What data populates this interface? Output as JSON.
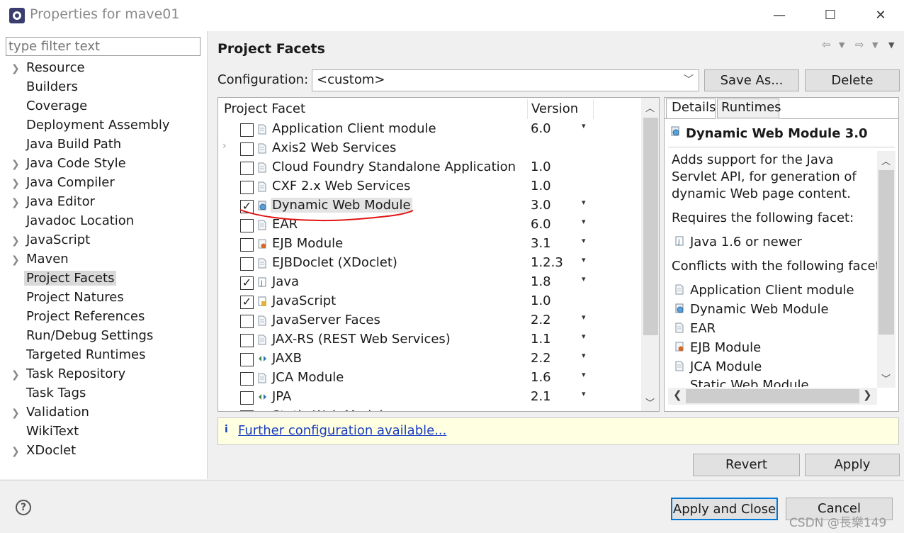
{
  "window": {
    "title": "Properties for mave01",
    "minimize": "—",
    "maximize": "☐",
    "close": "✕"
  },
  "filter": {
    "placeholder": "type filter text"
  },
  "tree": [
    {
      "label": "Resource",
      "expandable": true
    },
    {
      "label": "Builders",
      "expandable": false
    },
    {
      "label": "Coverage",
      "expandable": false
    },
    {
      "label": "Deployment Assembly",
      "expandable": false
    },
    {
      "label": "Java Build Path",
      "expandable": false
    },
    {
      "label": "Java Code Style",
      "expandable": true
    },
    {
      "label": "Java Compiler",
      "expandable": true
    },
    {
      "label": "Java Editor",
      "expandable": true
    },
    {
      "label": "Javadoc Location",
      "expandable": false
    },
    {
      "label": "JavaScript",
      "expandable": true
    },
    {
      "label": "Maven",
      "expandable": true
    },
    {
      "label": "Project Facets",
      "expandable": false,
      "selected": true
    },
    {
      "label": "Project Natures",
      "expandable": false
    },
    {
      "label": "Project References",
      "expandable": false
    },
    {
      "label": "Run/Debug Settings",
      "expandable": false
    },
    {
      "label": "Targeted Runtimes",
      "expandable": false
    },
    {
      "label": "Task Repository",
      "expandable": true
    },
    {
      "label": "Task Tags",
      "expandable": false
    },
    {
      "label": "Validation",
      "expandable": true
    },
    {
      "label": "WikiText",
      "expandable": false
    },
    {
      "label": "XDoclet",
      "expandable": true
    }
  ],
  "page": {
    "title": "Project Facets",
    "configuration_label": "Configuration:",
    "configuration_value": "<custom>",
    "save_as": "Save As...",
    "delete": "Delete"
  },
  "facets": {
    "col_facet": "Project Facet",
    "col_version": "Version",
    "rows": [
      {
        "name": "Application Client module",
        "version": "6.0",
        "checked": false,
        "dropdown": true,
        "expander": false,
        "icon": "page-icon"
      },
      {
        "name": "Axis2 Web Services",
        "version": "",
        "checked": false,
        "dropdown": false,
        "expander": true,
        "icon": "page-icon"
      },
      {
        "name": "Cloud Foundry Standalone Application",
        "version": "1.0",
        "checked": false,
        "dropdown": false,
        "expander": false,
        "icon": "page-icon"
      },
      {
        "name": "CXF 2.x Web Services",
        "version": "1.0",
        "checked": false,
        "dropdown": false,
        "expander": false,
        "icon": "page-icon"
      },
      {
        "name": "Dynamic Web Module",
        "version": "3.0",
        "checked": true,
        "dropdown": true,
        "expander": false,
        "icon": "web-globe-icon",
        "highlighted": true
      },
      {
        "name": "EAR",
        "version": "6.0",
        "checked": false,
        "dropdown": true,
        "expander": false,
        "icon": "page-icon"
      },
      {
        "name": "EJB Module",
        "version": "3.1",
        "checked": false,
        "dropdown": true,
        "expander": false,
        "icon": "ejb-bean-icon"
      },
      {
        "name": "EJBDoclet (XDoclet)",
        "version": "1.2.3",
        "checked": false,
        "dropdown": true,
        "expander": false,
        "icon": "page-icon"
      },
      {
        "name": "Java",
        "version": "1.8",
        "checked": true,
        "dropdown": true,
        "expander": false,
        "icon": "java-icon"
      },
      {
        "name": "JavaScript",
        "version": "1.0",
        "checked": true,
        "dropdown": false,
        "expander": false,
        "icon": "javascript-icon"
      },
      {
        "name": "JavaServer Faces",
        "version": "2.2",
        "checked": false,
        "dropdown": true,
        "expander": false,
        "icon": "page-icon"
      },
      {
        "name": "JAX-RS (REST Web Services)",
        "version": "1.1",
        "checked": false,
        "dropdown": true,
        "expander": false,
        "icon": "page-icon"
      },
      {
        "name": "JAXB",
        "version": "2.2",
        "checked": false,
        "dropdown": true,
        "expander": false,
        "icon": "arrows-icon"
      },
      {
        "name": "JCA Module",
        "version": "1.6",
        "checked": false,
        "dropdown": true,
        "expander": false,
        "icon": "page-icon"
      },
      {
        "name": "JPA",
        "version": "2.1",
        "checked": false,
        "dropdown": true,
        "expander": false,
        "icon": "arrows-icon"
      }
    ],
    "partial_row": "Static Web Module"
  },
  "details": {
    "tab_details": "Details",
    "tab_runtimes": "Runtimes",
    "heading": "Dynamic Web Module 3.0",
    "desc1": "Adds support for the Java",
    "desc2": "Servlet API, for generation of",
    "desc3": "dynamic Web page content.",
    "requires": "Requires the following facet:",
    "requires_item": "Java 1.6 or newer",
    "conflicts": "Conflicts with the following facet",
    "conflict_items": [
      "Application Client module",
      "Dynamic Web Module",
      "EAR",
      "EJB Module",
      "JCA Module"
    ],
    "conflict_partial": "Static Web Module"
  },
  "info": {
    "icon": "i",
    "link": "Further configuration available..."
  },
  "buttons": {
    "revert": "Revert",
    "apply": "Apply",
    "apply_close": "Apply and Close",
    "cancel": "Cancel"
  },
  "watermark": "CSDN @長樂149",
  "colors": {
    "link": "#1a3dc1",
    "annotation": "#e01515",
    "info_bg": "#ffffe1"
  }
}
